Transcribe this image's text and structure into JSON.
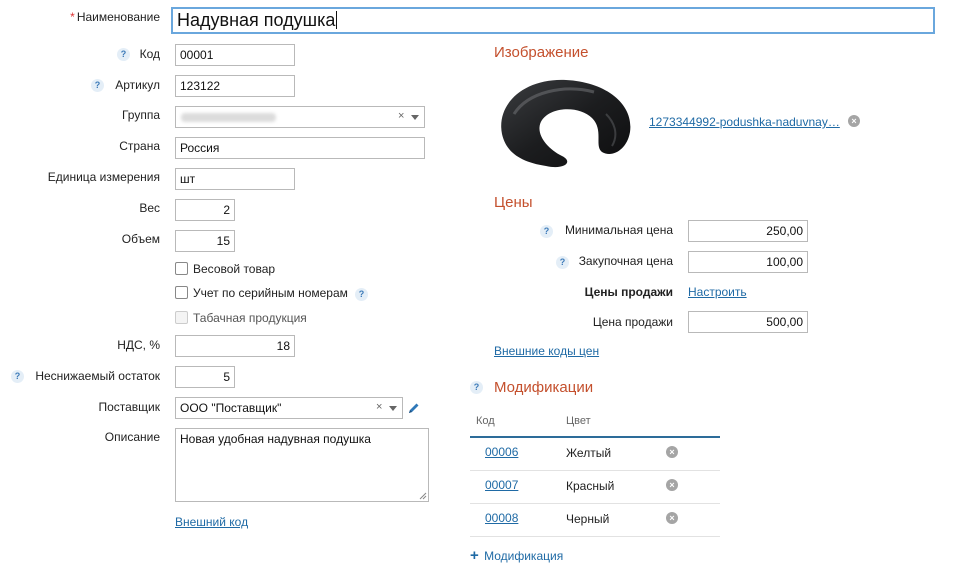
{
  "form": {
    "name_label": "Наименование",
    "name_required_mark": "*",
    "name_value": "Надувная подушка",
    "code_label": "Код",
    "code_value": "00001",
    "article_label": "Артикул",
    "article_value": "123122",
    "group_label": "Группа",
    "group_value": "",
    "country_label": "Страна",
    "country_value": "Россия",
    "unit_label": "Единица измерения",
    "unit_value": "шт",
    "weight_label": "Вес",
    "weight_value": "2",
    "volume_label": "Объем",
    "volume_value": "15",
    "weighted_label": "Весовой товар",
    "weighted_checked": false,
    "serial_label": "Учет по серийным номерам",
    "serial_checked": false,
    "tobacco_label": "Табачная продукция",
    "tobacco_checked": false,
    "vat_label": "НДС, %",
    "vat_value": "18",
    "min_balance_label": "Неснижаемый остаток",
    "min_balance_value": "5",
    "supplier_label": "Поставщик",
    "supplier_value": "ООО \"Поставщик\"",
    "description_label": "Описание",
    "description_value": "Новая удобная надувная подушка",
    "external_code_link": "Внешний код",
    "help_mark": "?",
    "clear_mark": "×"
  },
  "image_section": {
    "title": "Изображение",
    "file_name": "1273344992-podushka-naduvnay…",
    "remove_mark": "×"
  },
  "prices": {
    "title": "Цены",
    "min_price_label": "Минимальная цена",
    "min_price_value": "250,00",
    "purchase_price_label": "Закупочная цена",
    "purchase_price_value": "100,00",
    "sale_prices_label": "Цены продажи",
    "configure_link": "Настроить",
    "sale_price_label": "Цена продажи",
    "sale_price_value": "500,00",
    "external_codes_link": "Внешние коды цен"
  },
  "modifications": {
    "title": "Модификации",
    "columns": [
      "Код",
      "Цвет"
    ],
    "rows": [
      {
        "code": "00006",
        "color": "Желтый"
      },
      {
        "code": "00007",
        "color": "Красный"
      },
      {
        "code": "00008",
        "color": "Черный"
      }
    ],
    "add_link": "Модификация",
    "add_icon": "+"
  },
  "colors": {
    "accent_section": "#c4502d",
    "link": "#1f6aa5",
    "focus_border": "#6aa7dd"
  }
}
